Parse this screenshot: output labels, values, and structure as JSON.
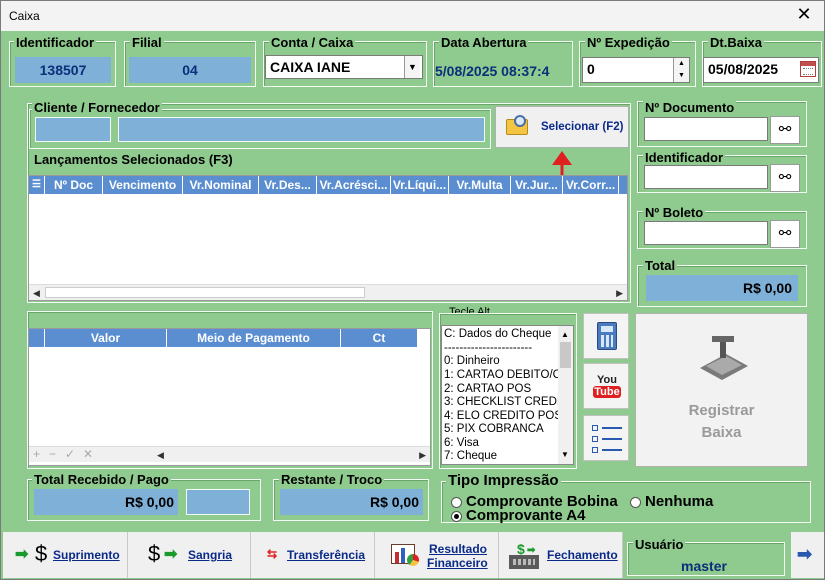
{
  "window": {
    "title": "Caixa",
    "close_glyph": "✕"
  },
  "identificador": {
    "label": "Identificador",
    "value": "138507"
  },
  "filial": {
    "label": "Filial",
    "value": "04"
  },
  "conta": {
    "label": "Conta / Caixa",
    "value": "CAIXA IANE"
  },
  "data_abertura": {
    "label": "Data Abertura",
    "value": "5/08/2025 08:37:4"
  },
  "expedicao": {
    "label": "Nº Expedição",
    "value": "0"
  },
  "dt_baixa": {
    "label": "Dt.Baixa",
    "value": "05/08/2025"
  },
  "cliente": {
    "label": "Cliente / Fornecedor"
  },
  "selecionar": {
    "label": "Selecionar (F2)"
  },
  "documento": {
    "label": "Nº Documento"
  },
  "identificador2": {
    "label": "Identificador"
  },
  "boleto": {
    "label": "Nº Boleto"
  },
  "total": {
    "label": "Total",
    "value": "R$ 0,00"
  },
  "lancamentos": {
    "label": "Lançamentos Selecionados (F3)",
    "columns": [
      "Nº Doc",
      "Vencimento",
      "Vr.Nominal",
      "Vr.Des...",
      "Vr.Acrésci...",
      "Vr.Líqui...",
      "Vr.Multa",
      "Vr.Jur...",
      "Vr.Corr..."
    ]
  },
  "pagamentos": {
    "columns": [
      "Valor",
      "Meio de Pagamento",
      "Ct"
    ]
  },
  "tecle_alt": {
    "label": "Tecle Alt",
    "selected": "C: Dados do Cheque",
    "separator": "-----------------------",
    "items": [
      "0: Dinheiro",
      "1: CARTAO DEBITO/C",
      "2: CARTAO POS",
      "3: CHECKLIST CREDIT",
      "4: ELO CREDITO POS",
      "5: PIX COBRANCA",
      "6: Visa",
      "7: Cheque"
    ]
  },
  "registrar": {
    "line1": "Registrar",
    "line2": "Baixa"
  },
  "total_recebido": {
    "label": "Total Recebido / Pago",
    "value": "R$ 0,00"
  },
  "restante": {
    "label": "Restante / Troco",
    "value": "R$ 0,00"
  },
  "tipo_impressao": {
    "label": "Tipo Impressão",
    "options": [
      "Comprovante Bobina",
      "Nenhuma",
      "Comprovante A4"
    ],
    "selected_index": 2
  },
  "bottom": {
    "suprimento": "Suprimento",
    "sangria": "Sangria",
    "transferencia": "Transferência",
    "resultado_line1": "Resultado",
    "resultado_line2": "Financeiro",
    "fechamento": "Fechamento"
  },
  "usuario": {
    "label": "Usuário",
    "value": "master"
  },
  "colors": {
    "accent_red": "#e02020",
    "header_blue": "#5a8ed0",
    "field_blue": "#7fb0d8",
    "panel_green": "#8fca8f"
  }
}
